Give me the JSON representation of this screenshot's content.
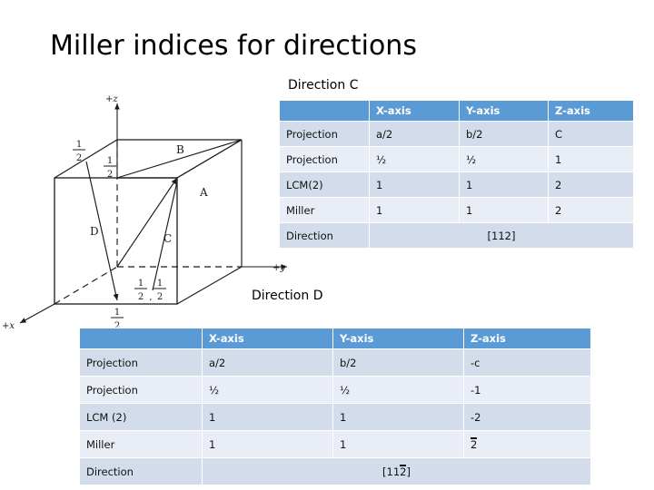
{
  "slide": {
    "title": "Miller indices for directions"
  },
  "figure": {
    "name": "unit-cell-directions-diagram",
    "axis_labels": {
      "z": "+z",
      "y": "+y",
      "x": "+x"
    },
    "vector_labels": [
      "A",
      "B",
      "C",
      "D"
    ],
    "fraction_annotations": [
      {
        "id": "top-left-half",
        "num": "1",
        "den": "2"
      },
      {
        "id": "top-mid-half",
        "num": "1",
        "den": "2"
      },
      {
        "id": "bottom-front-half",
        "num": "1",
        "den": "2"
      },
      {
        "id": "inner-half-a",
        "num": "1",
        "den": "2"
      },
      {
        "id": "inner-half-b",
        "num": "1",
        "den": "2"
      }
    ]
  },
  "sections": {
    "direction_c_caption": "Direction C",
    "direction_d_caption": "Direction D"
  },
  "table_c": {
    "headers": [
      "",
      "X-axis",
      "Y-axis",
      "Z-axis"
    ],
    "rows": [
      {
        "label": "Projection",
        "x": "a/2",
        "y": "b/2",
        "z": "C"
      },
      {
        "label": "Projection",
        "x": "½",
        "y": "½",
        "z": "1"
      },
      {
        "label": "LCM(2)",
        "x": "1",
        "y": "1",
        "z": "2"
      },
      {
        "label": "Miller",
        "x": "1",
        "y": "1",
        "z": "2"
      }
    ],
    "direction_row": {
      "label": "Direction",
      "value_prefix": "[112",
      "value_overbar": "",
      "value_suffix": "]"
    }
  },
  "table_d": {
    "headers": [
      "",
      "X-axis",
      "Y-axis",
      "Z-axis"
    ],
    "rows": [
      {
        "label": "Projection",
        "x": "a/2",
        "y": "b/2",
        "z": "-c"
      },
      {
        "label": "Projection",
        "x": "½",
        "y": "½",
        "z": "-1"
      },
      {
        "label": "LCM (2)",
        "x": "1",
        "y": "1",
        "z": "-2"
      }
    ],
    "miller_row": {
      "label": "Miller",
      "x": "1",
      "y": "1",
      "z_overbar": "2"
    },
    "direction_row": {
      "label": "Direction",
      "value_prefix": "[11",
      "value_overbar": "2",
      "value_suffix": "]"
    }
  },
  "colors": {
    "header_blue": "#5B9BD5",
    "row_dark": "#D2DCEB",
    "row_light": "#E9EDF5",
    "text": "#111111",
    "header_text": "#FFFFFF"
  }
}
